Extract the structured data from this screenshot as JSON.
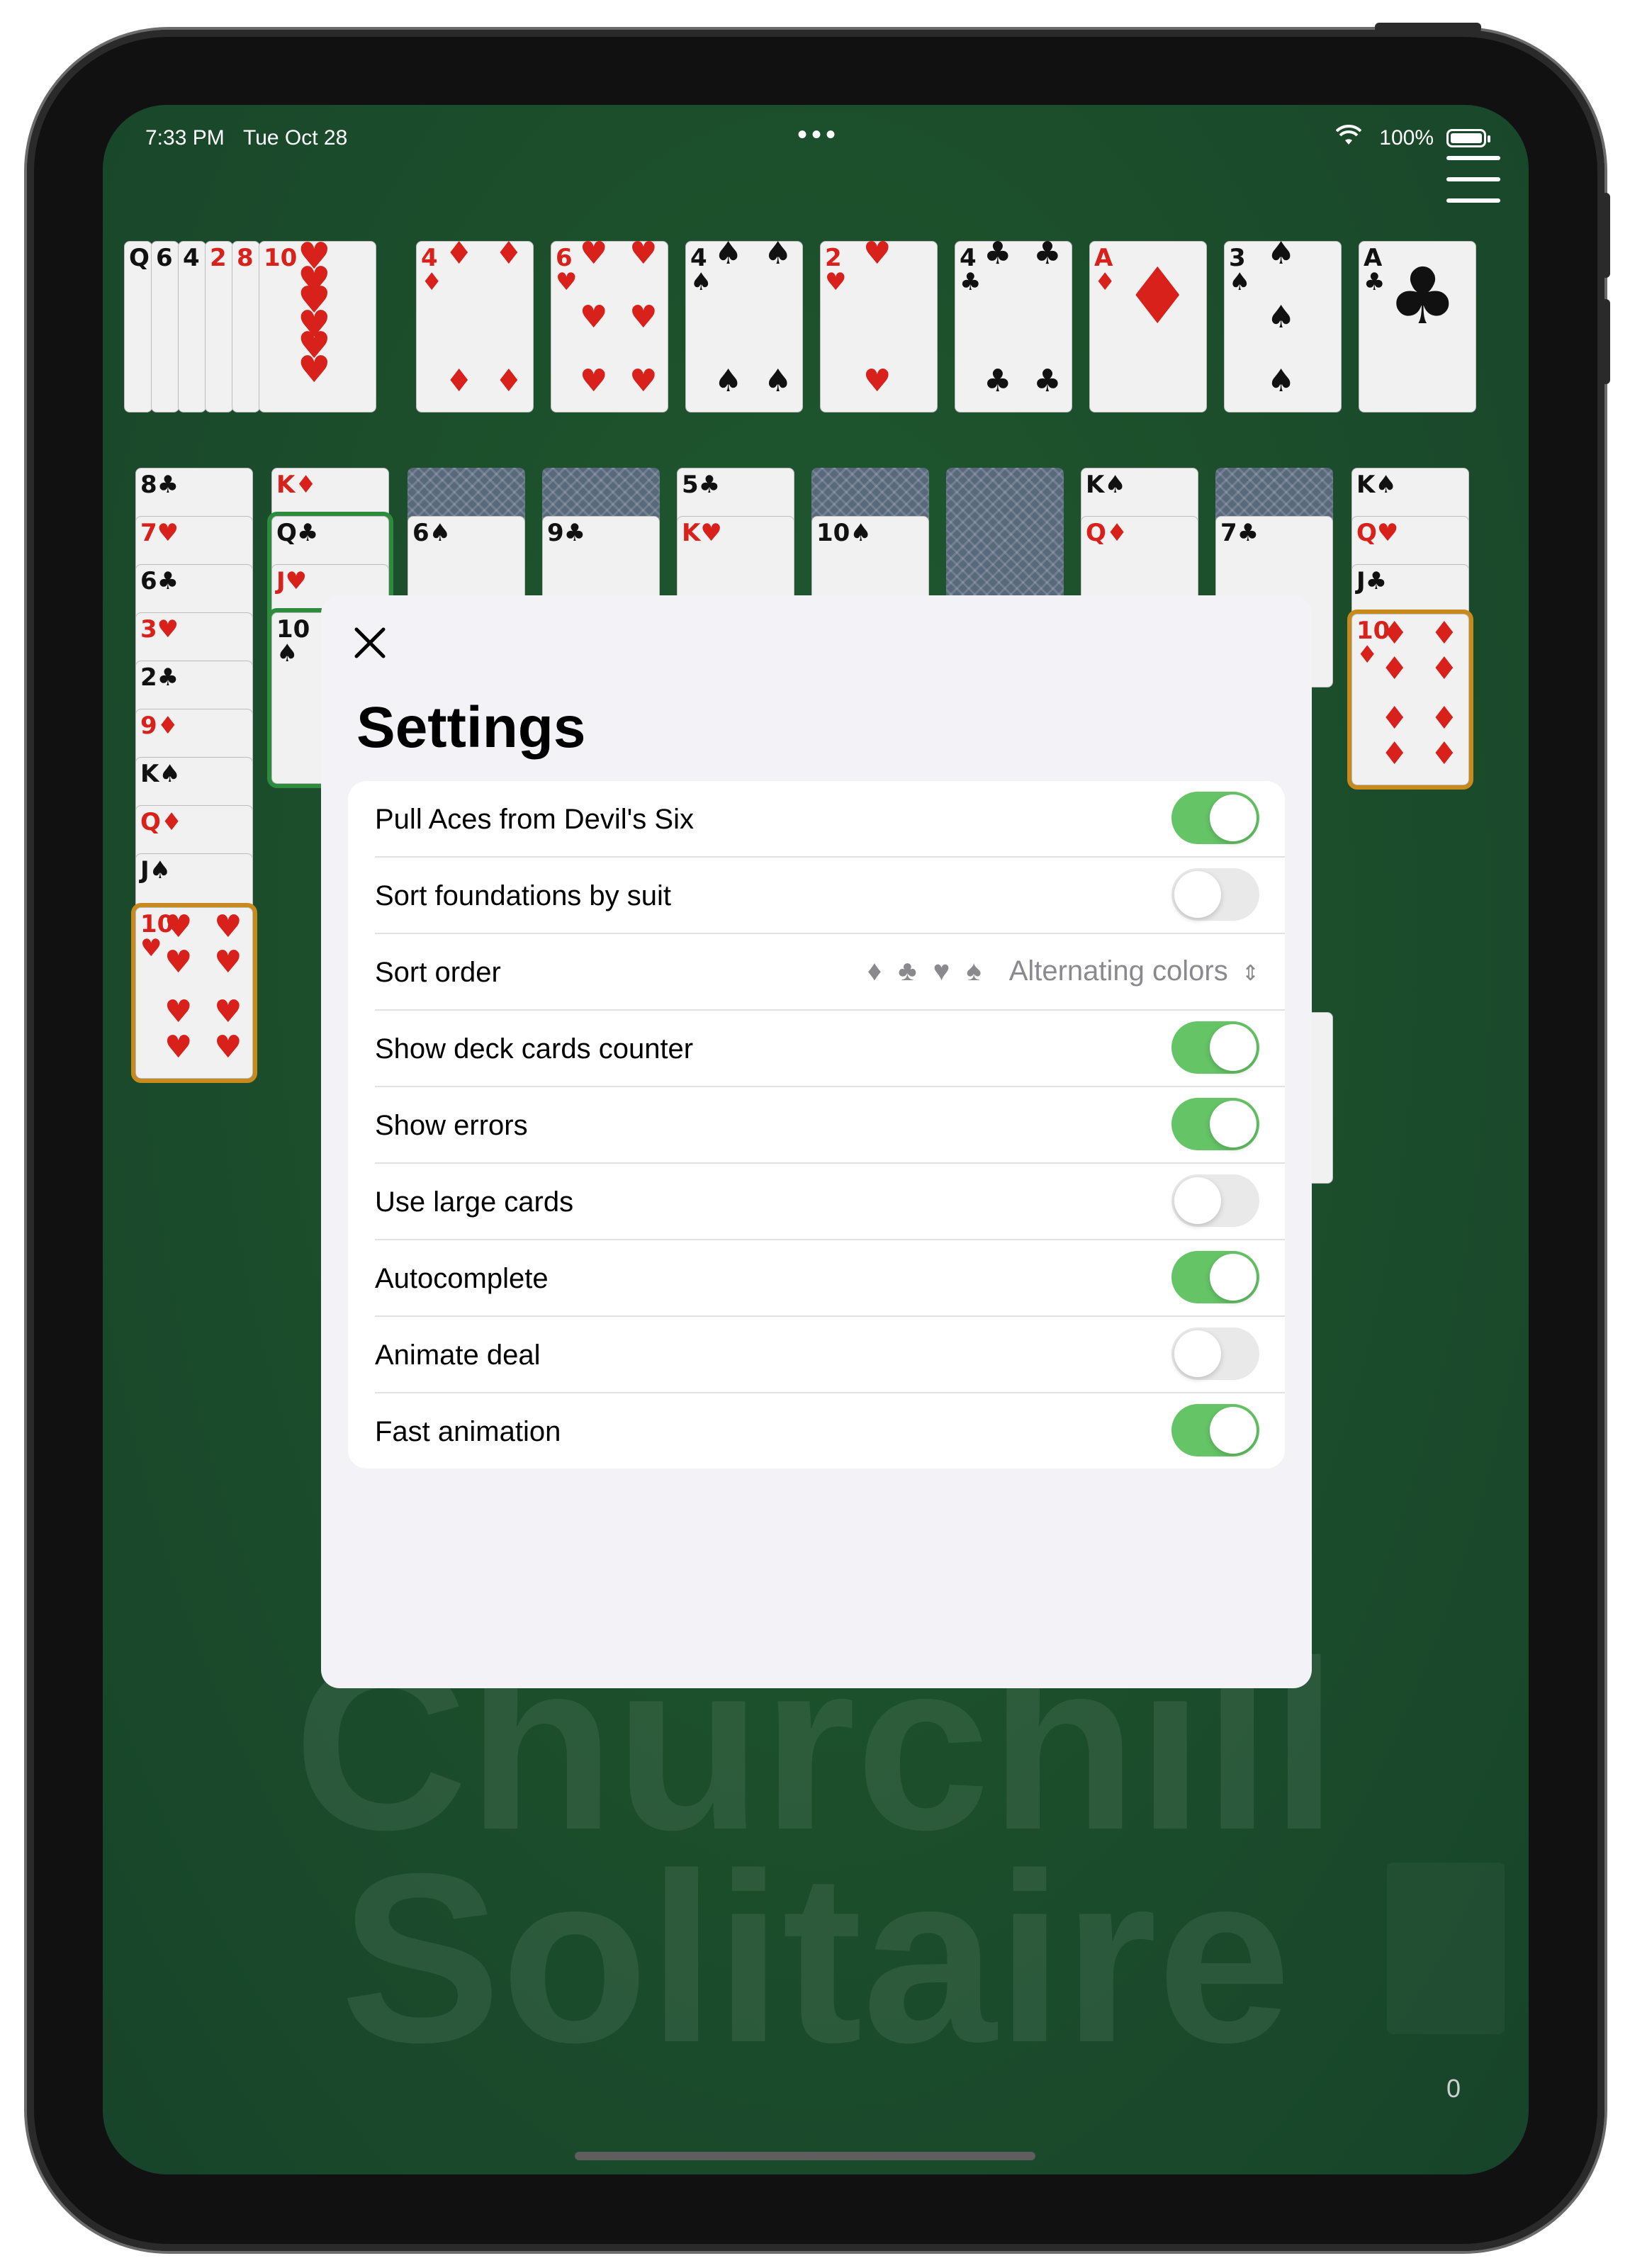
{
  "status_bar": {
    "time": "7:33 PM",
    "date": "Tue Oct 28",
    "battery": "100%"
  },
  "foundation_cards": [
    {
      "rank": "4",
      "suit": "♦",
      "color": "red"
    },
    {
      "rank": "6",
      "suit": "♥",
      "color": "red"
    },
    {
      "rank": "4",
      "suit": "♠",
      "color": "black"
    },
    {
      "rank": "2",
      "suit": "♥",
      "color": "red"
    },
    {
      "rank": "4",
      "suit": "♣",
      "color": "black"
    },
    {
      "rank": "A",
      "suit": "♦",
      "color": "red"
    },
    {
      "rank": "3",
      "suit": "♠",
      "color": "black"
    },
    {
      "rank": "A",
      "suit": "♣",
      "color": "black"
    }
  ],
  "devils_six_ranks": [
    "Q",
    "6",
    "4",
    "2",
    "8",
    "10"
  ],
  "background_title": {
    "line1": "Churchill",
    "line2": "Solitaire"
  },
  "deck_counter": "0",
  "settings": {
    "title": "Settings",
    "rows": [
      {
        "label": "Pull Aces from Devil's Six",
        "type": "toggle",
        "on": true
      },
      {
        "label": "Sort foundations by suit",
        "type": "toggle",
        "on": false
      },
      {
        "label": "Sort order",
        "type": "select",
        "suits": "♦ ♣ ♥ ♠",
        "value": "Alternating colors"
      },
      {
        "label": "Show deck cards counter",
        "type": "toggle",
        "on": true
      },
      {
        "label": "Show errors",
        "type": "toggle",
        "on": true
      },
      {
        "label": "Use large cards",
        "type": "toggle",
        "on": false
      },
      {
        "label": "Autocomplete",
        "type": "toggle",
        "on": true
      },
      {
        "label": "Animate deal",
        "type": "toggle",
        "on": false
      },
      {
        "label": "Fast animation",
        "type": "toggle",
        "on": true
      }
    ]
  },
  "colors": {
    "felt": "#1c4f2b",
    "toggle_on": "#65c466",
    "toggle_off": "#e9e9ea",
    "selection_orange": "#c98a1d",
    "selection_green": "#2e8b3d"
  }
}
